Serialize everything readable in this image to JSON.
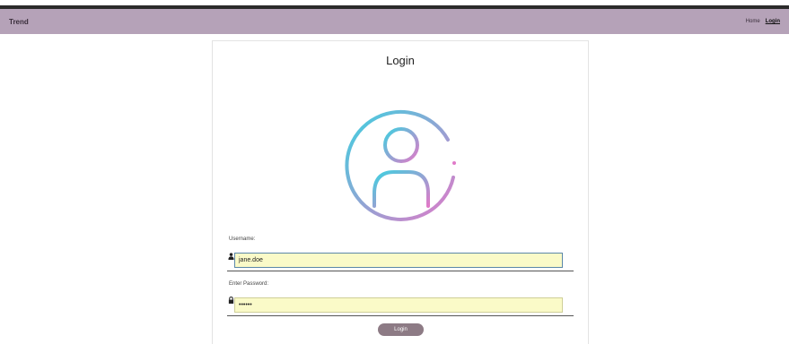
{
  "navbar": {
    "brand": "Trend",
    "links": [
      {
        "label": "Home",
        "active": false
      },
      {
        "label": "Login",
        "active": true
      }
    ]
  },
  "login_form": {
    "title": "Login",
    "username_label": "Username:",
    "username_value": "jane.doe",
    "password_label": "Enter Password:",
    "password_value": "••••••",
    "submit_label": "Login"
  },
  "icons": [
    "user-avatar-icon",
    "user-icon",
    "lock-icon"
  ],
  "colors": {
    "navbar_bg": "#b5a2b8",
    "input_bg": "#fafac8",
    "button_bg": "#8d7b85",
    "avatar_gradient_start": "#3fd0e0",
    "avatar_gradient_end": "#e07ac8"
  }
}
